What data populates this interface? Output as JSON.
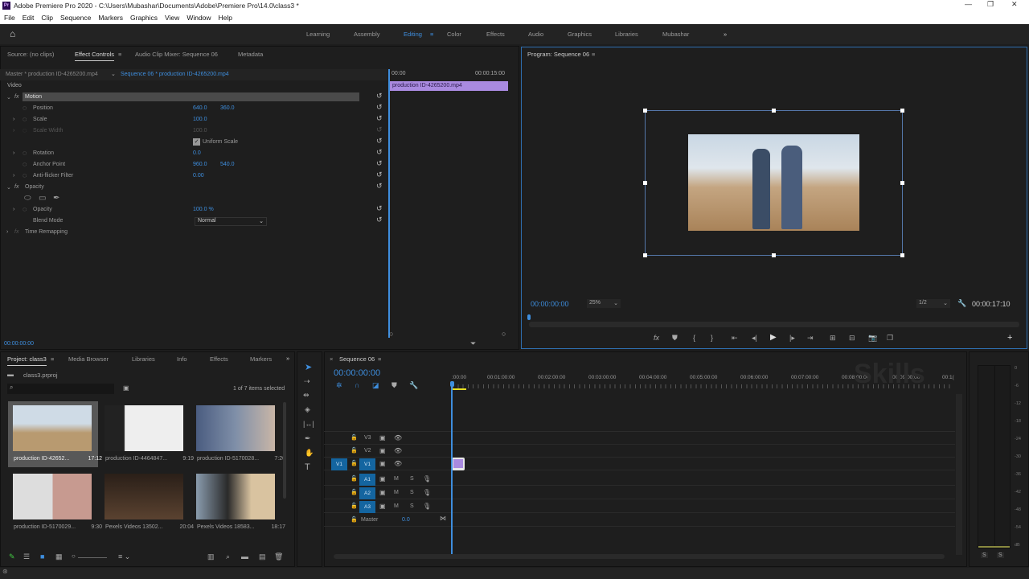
{
  "window": {
    "title": "Adobe Premiere Pro 2020 - C:\\Users\\Mubashar\\Documents\\Adobe\\Premiere Pro\\14.0\\class3 *",
    "min": "—",
    "max": "❐",
    "close": "✕"
  },
  "menu": [
    "File",
    "Edit",
    "Clip",
    "Sequence",
    "Markers",
    "Graphics",
    "View",
    "Window",
    "Help"
  ],
  "workspaces": [
    "Learning",
    "Assembly",
    "Editing",
    "Color",
    "Effects",
    "Audio",
    "Graphics",
    "Libraries",
    "Mubashar"
  ],
  "workspace_more": "»",
  "source_tabs": {
    "source": "Source: (no clips)",
    "effect_controls": "Effect Controls",
    "audio_mixer": "Audio Clip Mixer: Sequence 06",
    "metadata": "Metadata"
  },
  "effect_controls": {
    "master": "Master * production ID-4265200.mp4",
    "sequence": "Sequence 06 * production ID-4265200.mp4",
    "section": "Video",
    "mini_timeline": {
      "start": "00:00",
      "end": "00:00:15:00",
      "clip": "production ID-4265200.mp4"
    },
    "rows": [
      {
        "label": "Motion",
        "v1": "",
        "v2": ""
      },
      {
        "label": "Position",
        "v1": "640.0",
        "v2": "360.0"
      },
      {
        "label": "Scale",
        "v1": "100.0",
        "v2": ""
      },
      {
        "label": "Scale Width",
        "v1": "100.0",
        "v2": ""
      },
      {
        "label": "",
        "v1": "Uniform Scale",
        "v2": ""
      },
      {
        "label": "Rotation",
        "v1": "0.0",
        "v2": ""
      },
      {
        "label": "Anchor Point",
        "v1": "960.0",
        "v2": "540.0"
      },
      {
        "label": "Anti-flicker Filter",
        "v1": "0.00",
        "v2": ""
      },
      {
        "label": "Opacity",
        "v1": "",
        "v2": ""
      },
      {
        "label": "",
        "v1": "",
        "v2": ""
      },
      {
        "label": "Opacity",
        "v1": "100.0 %",
        "v2": ""
      },
      {
        "label": "Blend Mode",
        "v1": "Normal",
        "v2": ""
      },
      {
        "label": "Time Remapping",
        "v1": "",
        "v2": ""
      }
    ],
    "fx": "fx",
    "timecode": "00:00:00:00"
  },
  "program": {
    "title": "Program: Sequence 06",
    "timecode": "00:00:00:00",
    "zoom": "25%",
    "resolution": "1/2",
    "duration": "00:00:17:10"
  },
  "project": {
    "tabs": [
      "Project: class3",
      "Media Browser",
      "Libraries",
      "Info",
      "Effects",
      "Markers"
    ],
    "more": "»",
    "file": "class3.prproj",
    "search_placeholder": "",
    "selection": "1 of 7 items selected",
    "items": [
      {
        "name": "production ID-42652...",
        "dur": "17:12"
      },
      {
        "name": "production ID-4464847...",
        "dur": "9:19"
      },
      {
        "name": "production ID-5170028...",
        "dur": "7:20"
      },
      {
        "name": "production ID-5170029...",
        "dur": "9:30"
      },
      {
        "name": "Pexels Videos 13502...",
        "dur": "20:04"
      },
      {
        "name": "Pexels Videos 18583...",
        "dur": "18:17"
      }
    ]
  },
  "timeline": {
    "title": "Sequence 06",
    "close": "×",
    "timecode": "00:00:00:00",
    "ruler": [
      ":00:00",
      "00:01:00:00",
      "00:02:00:00",
      "00:03:00:00",
      "00:04:00:00",
      "00:05:00:00",
      "00:06:00:00",
      "00:07:00:00",
      "00:08:00:00",
      "00:09:00:00",
      "00:1("
    ],
    "video_tracks": [
      "V3",
      "V2",
      "V1"
    ],
    "source_patch": "V1",
    "audio_tracks": [
      "A1",
      "A2",
      "A3"
    ],
    "mute": "M",
    "solo": "S",
    "master": "Master",
    "master_val": "0.0",
    "watermark": "Skills"
  },
  "meters": {
    "scale": [
      "0",
      "-6",
      "-12",
      "-18",
      "-24",
      "-30",
      "-36",
      "-42",
      "-48",
      "-54",
      "dB"
    ],
    "solo": [
      "S",
      "S"
    ]
  }
}
